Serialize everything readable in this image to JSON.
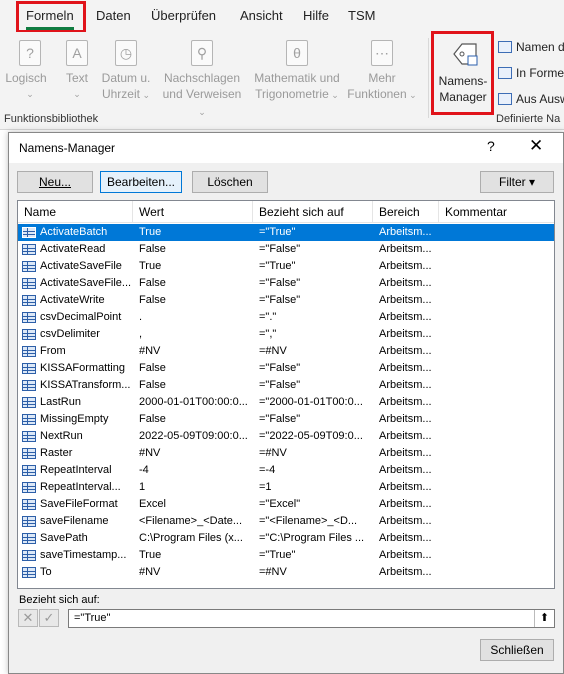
{
  "ribbon": {
    "tabs": [
      "Formeln",
      "Daten",
      "Überprüfen",
      "Ansicht",
      "Hilfe",
      "TSM"
    ],
    "active_tab": "Formeln",
    "groups": [
      {
        "label": "Logisch",
        "icon": "question-book-icon"
      },
      {
        "label": "Text",
        "icon": "text-a-icon"
      },
      {
        "label": "Datum u. Uhrzeit",
        "line1": "Datum u.",
        "line2": "Uhrzeit",
        "icon": "clock-book-icon"
      },
      {
        "label": "Nachschlagen und Verweisen",
        "line1": "Nachschlagen",
        "line2": "und Verweisen",
        "icon": "magnifier-book-icon"
      },
      {
        "label": "Mathematik und Trigonometrie",
        "line1": "Mathematik und",
        "line2": "Trigonometrie",
        "icon": "theta-book-icon"
      },
      {
        "label": "Mehr Funktionen",
        "line1": "Mehr",
        "line2": "Funktionen",
        "icon": "more-book-icon"
      }
    ],
    "function_library_label": "Funktionsbibliothek",
    "names_manager": {
      "line1": "Namens-",
      "line2": "Manager"
    },
    "small_buttons": [
      "Namen d",
      "In Forme",
      "Aus Ausw"
    ],
    "defined_names_label": "Definierte Na",
    "accent_color": "#107c41",
    "highlight_color": "#e0131a"
  },
  "dialog": {
    "title": "Namens-Manager",
    "help": "?",
    "close": "✕",
    "buttons": {
      "new": "Neu...",
      "edit": "Bearbeiten...",
      "delete": "Löschen",
      "filter": "Filter ▾"
    },
    "columns": [
      "Name",
      "Wert",
      "Bezieht sich auf",
      "Bereich",
      "Kommentar"
    ],
    "rows": [
      {
        "name": "ActivateBatch",
        "value": "True",
        "refers": "=\"True\"",
        "scope": "Arbeitsm...",
        "selected": true
      },
      {
        "name": "ActivateRead",
        "value": "False",
        "refers": "=\"False\"",
        "scope": "Arbeitsm..."
      },
      {
        "name": "ActivateSaveFile",
        "value": "True",
        "refers": "=\"True\"",
        "scope": "Arbeitsm..."
      },
      {
        "name": "ActivateSaveFile...",
        "value": "False",
        "refers": "=\"False\"",
        "scope": "Arbeitsm..."
      },
      {
        "name": "ActivateWrite",
        "value": "False",
        "refers": "=\"False\"",
        "scope": "Arbeitsm..."
      },
      {
        "name": "csvDecimalPoint",
        "value": ".",
        "refers": "=\".\"",
        "scope": "Arbeitsm..."
      },
      {
        "name": "csvDelimiter",
        "value": ",",
        "refers": "=\",\"",
        "scope": "Arbeitsm..."
      },
      {
        "name": "From",
        "value": "#NV",
        "refers": "=#NV",
        "scope": "Arbeitsm..."
      },
      {
        "name": "KISSAFormatting",
        "value": "False",
        "refers": "=\"False\"",
        "scope": "Arbeitsm..."
      },
      {
        "name": "KISSATransform...",
        "value": "False",
        "refers": "=\"False\"",
        "scope": "Arbeitsm..."
      },
      {
        "name": "LastRun",
        "value": "2000-01-01T00:00:0...",
        "refers": "=\"2000-01-01T00:0...",
        "scope": "Arbeitsm..."
      },
      {
        "name": "MissingEmpty",
        "value": "False",
        "refers": "=\"False\"",
        "scope": "Arbeitsm..."
      },
      {
        "name": "NextRun",
        "value": "2022-05-09T09:00:0...",
        "refers": "=\"2022-05-09T09:0...",
        "scope": "Arbeitsm..."
      },
      {
        "name": "Raster",
        "value": "#NV",
        "refers": "=#NV",
        "scope": "Arbeitsm..."
      },
      {
        "name": "RepeatInterval",
        "value": "-4",
        "refers": "=-4",
        "scope": "Arbeitsm..."
      },
      {
        "name": "RepeatInterval...",
        "value": "1",
        "refers": "=1",
        "scope": "Arbeitsm..."
      },
      {
        "name": "SaveFileFormat",
        "value": "Excel",
        "refers": "=\"Excel\"",
        "scope": "Arbeitsm..."
      },
      {
        "name": "saveFilename",
        "value": "<Filename>_<Date...",
        "refers": "=\"<Filename>_<D...",
        "scope": "Arbeitsm..."
      },
      {
        "name": "SavePath",
        "value": "C:\\Program Files (x...",
        "refers": "=\"C:\\Program Files ...",
        "scope": "Arbeitsm..."
      },
      {
        "name": "saveTimestamp...",
        "value": "True",
        "refers": "=\"True\"",
        "scope": "Arbeitsm..."
      },
      {
        "name": "To",
        "value": "#NV",
        "refers": "=#NV",
        "scope": "Arbeitsm..."
      }
    ],
    "refers_to_label": "Bezieht sich auf:",
    "refers_to_value": "=\"True\"",
    "cancel_icon": "✕",
    "confirm_icon": "✓",
    "collapse_icon": "⬆",
    "close_button": "Schließen"
  }
}
